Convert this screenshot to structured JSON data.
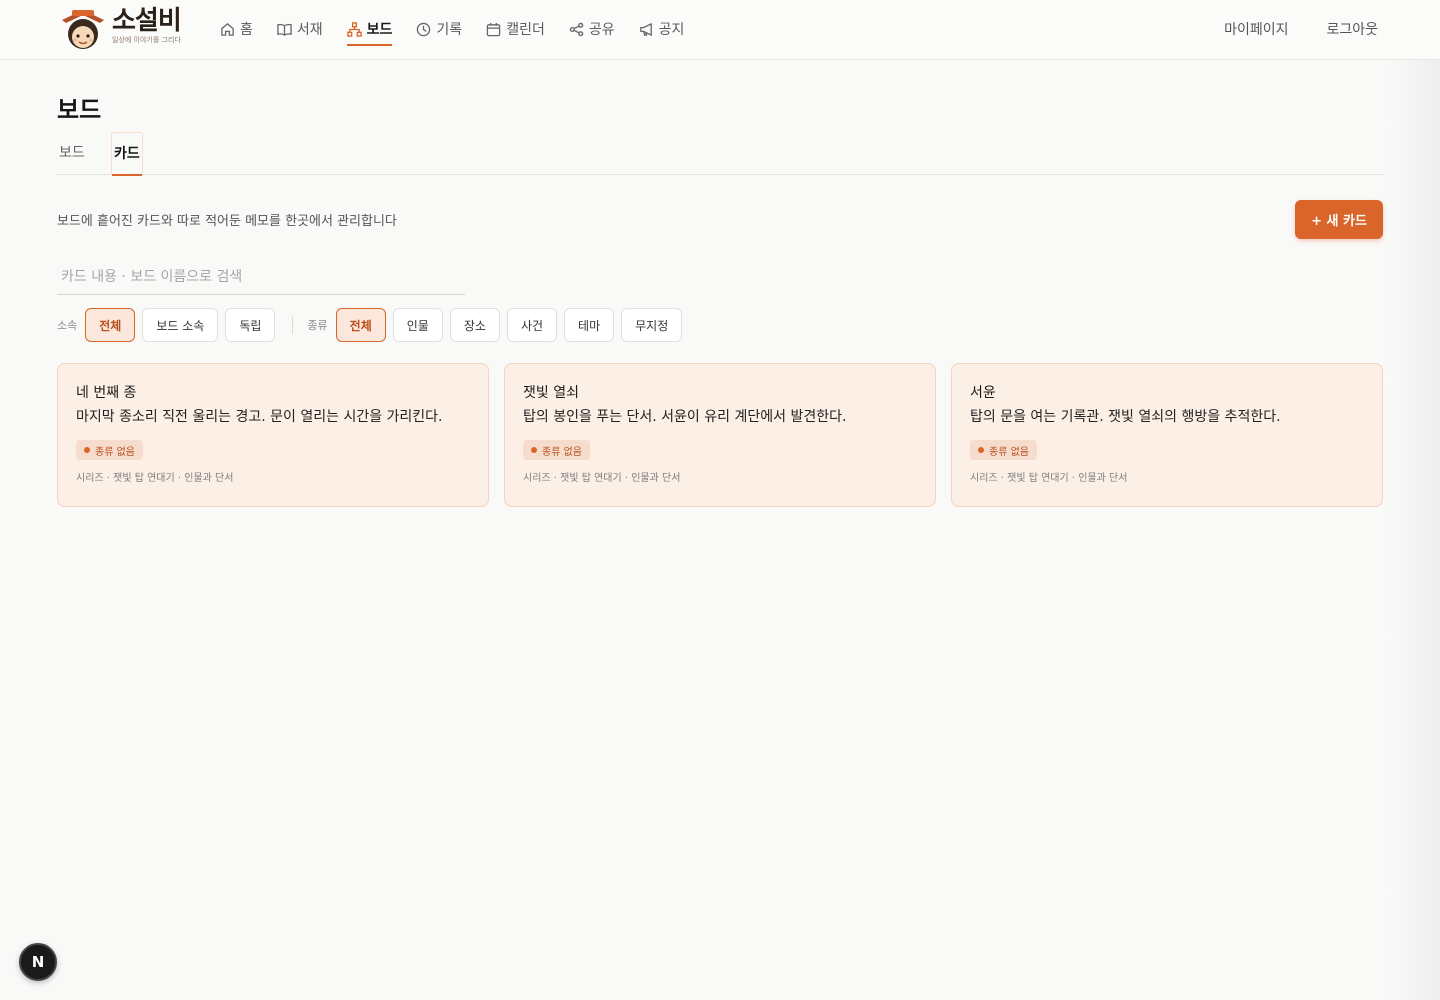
{
  "app": {
    "logo_title": "소설비",
    "logo_subtitle": "일상에 이야기를 그리다"
  },
  "nav": {
    "items": [
      {
        "label": "홈",
        "icon": "home-icon"
      },
      {
        "label": "서재",
        "icon": "book-icon"
      },
      {
        "label": "보드",
        "icon": "network-icon",
        "active": true
      },
      {
        "label": "기록",
        "icon": "clock-icon"
      },
      {
        "label": "캘린더",
        "icon": "calendar-icon"
      },
      {
        "label": "공유",
        "icon": "share-icon"
      },
      {
        "label": "공지",
        "icon": "megaphone-icon"
      }
    ],
    "right": [
      "마이페이지",
      "로그아웃"
    ]
  },
  "page": {
    "title": "보드",
    "tabs": [
      "보드",
      "카드"
    ],
    "active_tab": "카드",
    "description": "보드에 흩어진 카드와 따로 적어둔 메모를 한곳에서 관리합니다",
    "new_card_label": "+ 새 카드"
  },
  "search": {
    "placeholder": "카드 내용 · 보드 이름으로 검색",
    "value": ""
  },
  "filters": {
    "affiliation": {
      "label": "소속",
      "options": [
        "전체",
        "보드 소속",
        "독립"
      ],
      "selected": "전체"
    },
    "kind": {
      "label": "종류",
      "options": [
        "전체",
        "인물",
        "장소",
        "사건",
        "테마",
        "무지정"
      ],
      "selected": "전체"
    }
  },
  "cards": [
    {
      "title": "네 번째 종",
      "body": "마지막 종소리 직전 울리는 경고. 문이 열리는 시간을 가리킨다.",
      "badge": "종류 없음",
      "meta": "시리즈 · 잿빛 탑 연대기 · 인물과 단서"
    },
    {
      "title": "잿빛 열쇠",
      "body": "탑의 봉인을 푸는 단서. 서윤이 유리 계단에서 발견한다.",
      "badge": "종류 없음",
      "meta": "시리즈 · 잿빛 탑 연대기 · 인물과 단서"
    },
    {
      "title": "서윤",
      "body": "탑의 문을 여는 기록관. 잿빛 열쇠의 행방을 추적한다.",
      "badge": "종류 없음",
      "meta": "시리즈 · 잿빛 탑 연대기 · 인물과 단서"
    }
  ],
  "dev_badge": "N",
  "colors": {
    "accent": "#d9652a",
    "card_bg": "#fcefe6",
    "card_border": "#f3d2bf",
    "page_bg": "#f9f9f8"
  }
}
